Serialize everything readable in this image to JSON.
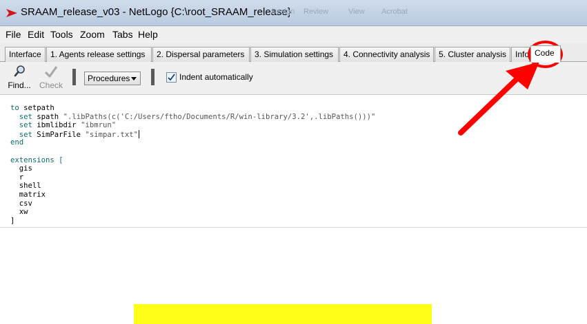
{
  "window": {
    "title": "SRAAM_release_v03 - NetLogo {C:\\root_SRAAM_release}",
    "ghost_titles": [
      "Design",
      "Review",
      "View",
      "Acrobat"
    ]
  },
  "menu": {
    "items": [
      "File",
      "Edit",
      "Tools",
      "Zoom",
      "Tabs",
      "Help"
    ]
  },
  "tabs": [
    {
      "label": "Interface"
    },
    {
      "label": "1. Agents release settings"
    },
    {
      "label": "2. Dispersal parameters"
    },
    {
      "label": "3. Simulation settings"
    },
    {
      "label": "4. Connectivity analysis"
    },
    {
      "label": "5. Cluster analysis"
    },
    {
      "label": "Info"
    },
    {
      "label": "Code",
      "active": true
    }
  ],
  "toolbar": {
    "find_label": "Find...",
    "check_label": "Check",
    "procedures_label": "Procedures",
    "indent_label": "Indent automatically",
    "indent_checked": true
  },
  "code": {
    "lines": [
      [
        [
          "kw",
          "to "
        ],
        [
          "",
          "setpath"
        ]
      ],
      [
        [
          "",
          "  "
        ],
        [
          "kw",
          "set"
        ],
        [
          "",
          " spath "
        ],
        [
          "str",
          "\".libPaths(c('C:/Users/ftho/Documents/R/win-library/3.2',.libPaths()))\""
        ]
      ],
      [
        [
          "",
          "  "
        ],
        [
          "kw",
          "set"
        ],
        [
          "",
          " ibmlibdir "
        ],
        [
          "str",
          "\"ibmrun\""
        ]
      ],
      [
        [
          "",
          "  "
        ],
        [
          "kw",
          "set"
        ],
        [
          "",
          " SimParFile "
        ],
        [
          "str",
          "\"simpar.txt\""
        ],
        [
          "cursor",
          ""
        ]
      ],
      [
        [
          "kw",
          "end"
        ]
      ],
      [
        [
          "",
          ""
        ]
      ],
      [
        [
          "kw",
          "extensions"
        ],
        [
          "",
          " "
        ],
        [
          "kw",
          "["
        ]
      ],
      [
        [
          "",
          "  gis"
        ]
      ],
      [
        [
          "",
          "  r"
        ]
      ],
      [
        [
          "",
          "  shell"
        ]
      ],
      [
        [
          "",
          "  matrix"
        ]
      ],
      [
        [
          "",
          "  csv"
        ]
      ],
      [
        [
          "",
          "  xw"
        ]
      ],
      [
        [
          "bracket",
          "]"
        ]
      ]
    ]
  },
  "colors": {
    "annotation": "#ff0000",
    "highlight_bar": "#ffff1a",
    "keyword": "#0b6c6c"
  }
}
